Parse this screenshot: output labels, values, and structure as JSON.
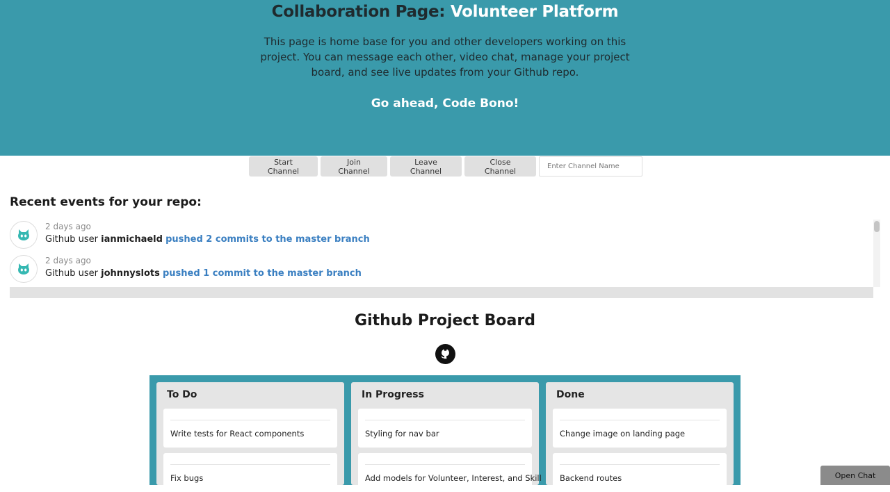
{
  "hero": {
    "title_prefix": "Collaboration Page: ",
    "title_accent": "Volunteer Platform",
    "description": "This page is home base for you and other developers working on this project. You can message each other, video chat, manage your project board, and see live updates from your Github repo.",
    "cta": "Go ahead, Code Bono!",
    "background_color": "#3a9aab"
  },
  "channel": {
    "buttons": [
      "Start Channel",
      "Join Channel",
      "Leave Channel",
      "Close Channel"
    ],
    "input_placeholder": "Enter Channel Name"
  },
  "events": {
    "heading": "Recent events for your repo:",
    "items": [
      {
        "time": "2 days ago",
        "prefix": "Github user ",
        "user": "ianmichaeld",
        "action": "pushed 2 commits to the master branch",
        "icon": "github-octocat-icon"
      },
      {
        "time": "2 days ago",
        "prefix": "Github user ",
        "user": "johnnyslots",
        "action": "pushed 1 commit to the master branch",
        "icon": "github-octocat-icon"
      }
    ],
    "link_color": "#3a7fc1"
  },
  "board": {
    "title": "Github Project Board",
    "icon": "github-icon",
    "columns": [
      {
        "title": "To Do",
        "cards": [
          "Write tests for React components",
          "Fix bugs"
        ]
      },
      {
        "title": "In Progress",
        "cards": [
          "Styling for nav bar",
          "Add models for Volunteer, Interest, and Skill"
        ]
      },
      {
        "title": "Done",
        "cards": [
          "Change image on landing page",
          "Backend routes"
        ]
      }
    ]
  },
  "chat": {
    "open_label": "Open Chat"
  }
}
